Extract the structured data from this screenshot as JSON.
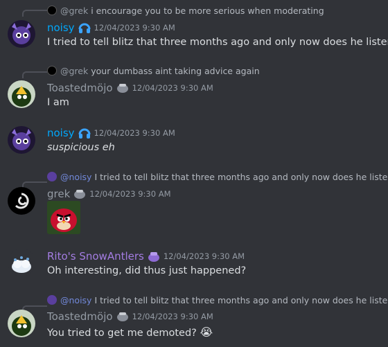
{
  "messages": [
    {
      "reply": {
        "mention": "@grek",
        "text": "i encourage you to be more serious when moderating"
      },
      "author": "noisy",
      "author_color": "#00a8fc",
      "time": "12/04/2023 9:30 AM",
      "text": "I tried to tell blitz that three months ago and only now does he listen"
    },
    {
      "reply": {
        "mention": "@grek",
        "text": "your dumbass aint taking advice again"
      },
      "author": "Toastedmöjo",
      "author_color": "#949ba4",
      "time": "12/04/2023 9:30 AM",
      "text": "I am"
    },
    {
      "author": "noisy",
      "author_color": "#00a8fc",
      "time": "12/04/2023 9:30 AM",
      "text": "suspicious eh"
    },
    {
      "reply": {
        "mention": "@noisy",
        "text": "I tried to tell blitz that three months ago and only now does he listen"
      },
      "author": "grek",
      "author_color": "#949ba4",
      "time": "12/04/2023 9:30 AM"
    },
    {
      "author": "Rito's SnowAntlers",
      "author_color": "#a47de2",
      "time": "12/04/2023 9:30 AM",
      "text": "Oh interesting, did thus just happened?"
    },
    {
      "reply": {
        "mention": "@noisy",
        "text": "I tried to tell blitz that three months ago and only now does he listen"
      },
      "author": "Toastedmöjo",
      "author_color": "#949ba4",
      "time": "12/04/2023 9:30 AM",
      "text": "You tried to get me demoted?",
      "emoji": "😭"
    }
  ]
}
